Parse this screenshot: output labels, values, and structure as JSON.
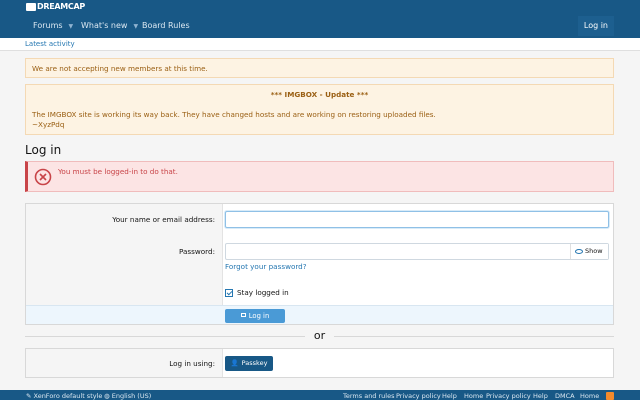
{
  "header": {
    "logo_text": "DREAMCAP",
    "nav": [
      {
        "label": "Forums",
        "has_caret": true
      },
      {
        "label": "What's new",
        "has_caret": true
      },
      {
        "label": "Board Rules",
        "has_caret": false
      }
    ],
    "login_label": "Log in"
  },
  "subnav": {
    "latest_activity": "Latest activity"
  },
  "notices": {
    "registration": "We are not accepting new members at this time.",
    "imgbox_title": "*** IMGBOX - Update ***",
    "imgbox_body": "The IMGBOX site is working its way back. They have changed hosts and are working on restoring uploaded files.",
    "imgbox_sign": "~XyzPdq"
  },
  "page": {
    "title": "Log in"
  },
  "error": {
    "message": "You must be logged-in to do that."
  },
  "form": {
    "name_label": "Your name or email address:",
    "name_value": "",
    "password_label": "Password:",
    "password_value": "",
    "show_label": "Show",
    "forgot_label": "Forgot your password?",
    "stay_logged_in_label": "Stay logged in",
    "stay_logged_in_checked": true,
    "submit_label": "Log in"
  },
  "separator": {
    "or_text": "or"
  },
  "passkey": {
    "label": "Log in using:",
    "button_label": "Passkey"
  },
  "footer": {
    "style_label": "XenForo default style",
    "language_label": "English (US)",
    "links": [
      "Terms and rules",
      "Privacy policy",
      "Help",
      "Home",
      "Privacy policy",
      "Help",
      "DMCA",
      "Home"
    ]
  },
  "colors": {
    "header_bg": "#185886",
    "link": "#2577b1",
    "notice_bg": "#fdf3e3",
    "error": "#c84448",
    "submit_bg": "#4a9ad6"
  }
}
